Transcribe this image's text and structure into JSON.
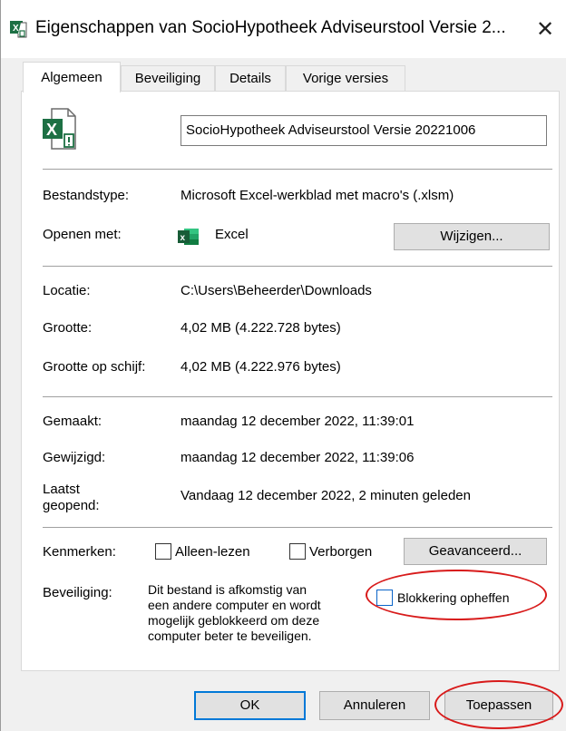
{
  "window": {
    "title": "Eigenschappen van SocioHypotheek Adviseurstool Versie 2...",
    "close_icon": "close-icon"
  },
  "tabs": [
    {
      "label": "Algemeen",
      "active": true
    },
    {
      "label": "Beveiliging",
      "active": false
    },
    {
      "label": "Details",
      "active": false
    },
    {
      "label": "Vorige versies",
      "active": false
    }
  ],
  "file": {
    "name": "SocioHypotheek Adviseurstool Versie 20221006",
    "icon": "excel-macro-file-icon"
  },
  "type_section": {
    "type_label": "Bestandstype:",
    "type_value": "Microsoft Excel-werkblad met macro's (.xlsm)",
    "open_with_label": "Openen met:",
    "open_with_value": "Excel",
    "change_button": "Wijzigen..."
  },
  "location_section": {
    "location_label": "Locatie:",
    "location_value": "C:\\Users\\Beheerder\\Downloads",
    "size_label": "Grootte:",
    "size_value": "4,02 MB (4.222.728 bytes)",
    "size_on_disk_label": "Grootte op schijf:",
    "size_on_disk_value": "4,02 MB (4.222.976 bytes)"
  },
  "dates_section": {
    "created_label": "Gemaakt:",
    "created_value": "maandag 12 december 2022, 11:39:01",
    "modified_label": "Gewijzigd:",
    "modified_value": "maandag 12 december 2022, 11:39:06",
    "accessed_label_line1": "Laatst",
    "accessed_label_line2": "geopend:",
    "accessed_value": "Vandaag 12 december 2022, 2 minuten geleden"
  },
  "attributes": {
    "label": "Kenmerken:",
    "readonly_label": "Alleen-lezen",
    "readonly_checked": false,
    "hidden_label": "Verborgen",
    "hidden_checked": false,
    "advanced_button": "Geavanceerd..."
  },
  "security": {
    "label": "Beveiliging:",
    "message_lines": [
      "Dit bestand is afkomstig van",
      "een andere computer en wordt",
      "mogelijk geblokkeerd om deze",
      "computer beter te beveiligen."
    ],
    "unblock_label": "Blokkering opheffen",
    "unblock_checked": false
  },
  "footer": {
    "ok_button": "OK",
    "cancel_button": "Annuleren",
    "apply_button": "Toepassen"
  },
  "colors": {
    "annotation": "#d81b1b",
    "excel_green": "#1d7044",
    "focus_blue": "#0078d7"
  }
}
